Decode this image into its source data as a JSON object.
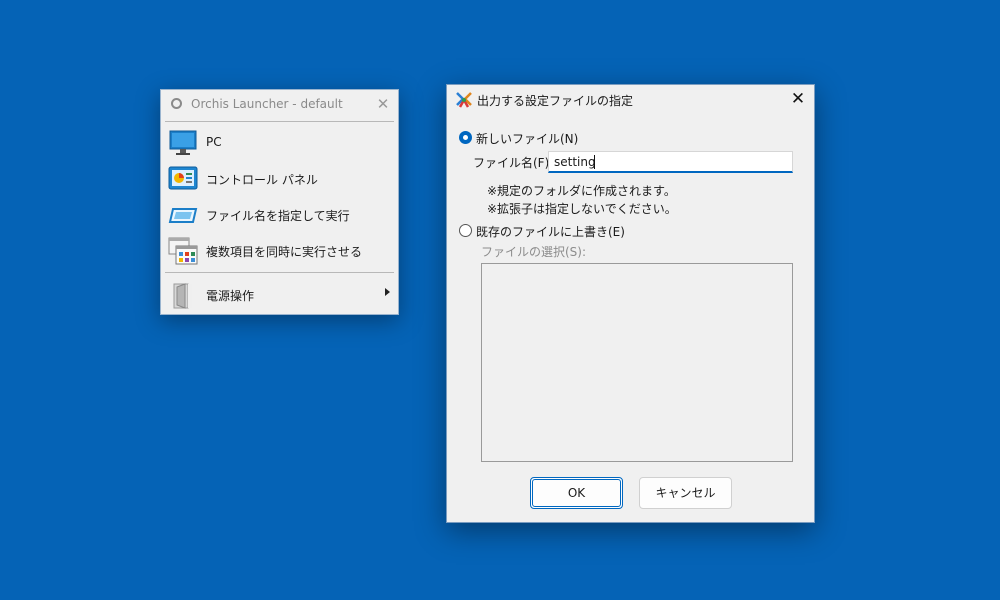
{
  "launcher": {
    "title": "Orchis Launcher - default",
    "items": [
      {
        "label": "PC",
        "icon": "monitor-icon"
      },
      {
        "label": "コントロール パネル",
        "icon": "control-panel-icon"
      },
      {
        "label": "ファイル名を指定して実行",
        "icon": "run-icon"
      },
      {
        "label": "複数項目を同時に実行させる",
        "icon": "multi-run-icon"
      },
      {
        "label": "電源操作",
        "icon": "power-icon",
        "submenu": true
      }
    ]
  },
  "dialog": {
    "title": "出力する設定ファイルの指定",
    "new_file_option": "新しいファイル(N)",
    "filename_label": "ファイル名(F):",
    "filename_value": "setting",
    "note1": "※規定のフォルダに作成されます。",
    "note2": "※拡張子は指定しないでください。",
    "overwrite_option": "既存のファイルに上書き(E)",
    "file_select_label": "ファイルの選択(S):",
    "ok_label": "OK",
    "cancel_label": "キャンセル"
  },
  "colors": {
    "desktop": "#0563b6",
    "accent": "#0067c0",
    "window_bg": "#f0f0f0"
  }
}
